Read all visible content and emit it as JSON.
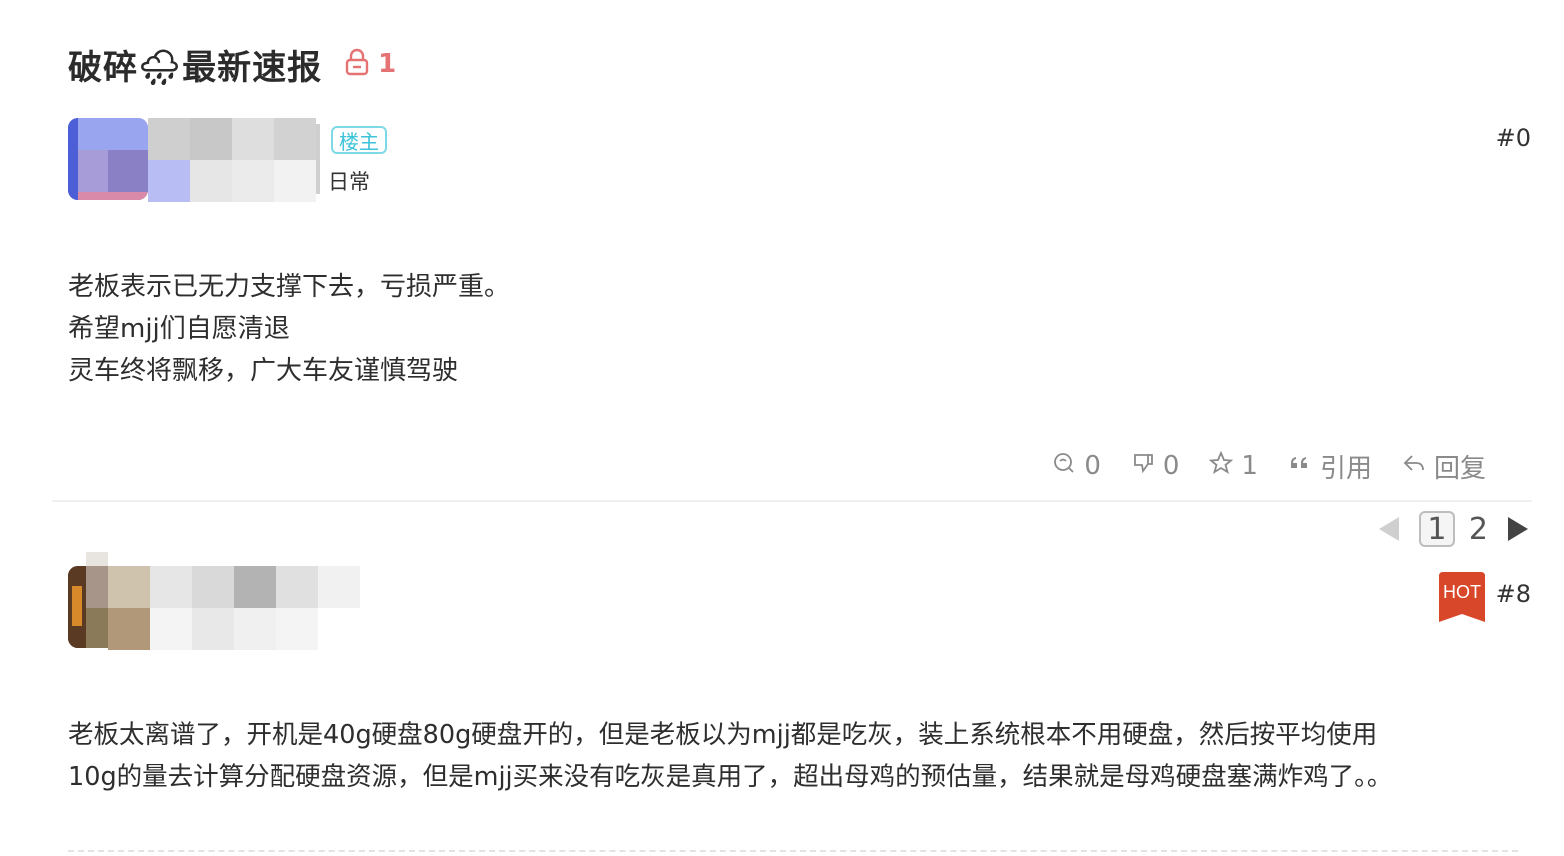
{
  "thread": {
    "title": "破碎🌧最新速报",
    "lock_count": "1"
  },
  "op_post": {
    "badge": "楼主",
    "user_group": "日常",
    "floor": "#0",
    "lines": [
      "老板表示已无力支撑下去，亏损严重。",
      "希望mjj们自愿清退",
      "灵车终将飘移，广大车友谨慎驾驶"
    ]
  },
  "actions": {
    "like_count": "0",
    "dislike_count": "0",
    "star_count": "1",
    "quote_label": "引用",
    "reply_label": "回复"
  },
  "pagination": {
    "current": "1",
    "next": "2"
  },
  "reply_post": {
    "hot_label": "HOT",
    "floor": "#8",
    "lines": [
      "老板太离谱了，开机是40g硬盘80g硬盘开的，但是老板以为mjj都是吃灰，装上系统根本不用硬盘，然后按平均使用",
      "10g的量去计算分配硬盘资源，但是mjj买来没有吃灰是真用了，超出母鸡的预估量，结果就是母鸡硬盘塞满炸鸡了。。"
    ]
  },
  "colors": {
    "lock": "#e57373",
    "op_badge": "#3cc3d8",
    "hot_badge": "#d9472b"
  }
}
